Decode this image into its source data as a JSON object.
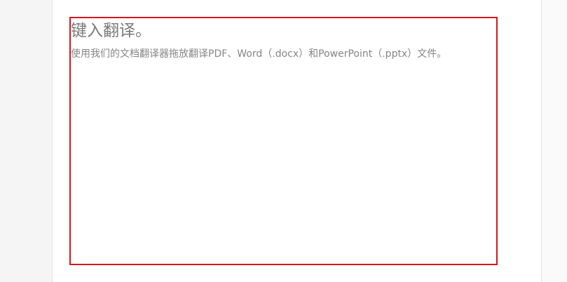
{
  "translator": {
    "input_placeholder_title": "键入翻译。",
    "input_placeholder_hint": "使用我们的文档翻译器拖放翻译PDF、Word（.docx）和PowerPoint（.pptx）文件。"
  },
  "colors": {
    "focus_border": "#d9141b",
    "placeholder_text": "#7a7a7a",
    "page_background": "#f5f5f5"
  }
}
